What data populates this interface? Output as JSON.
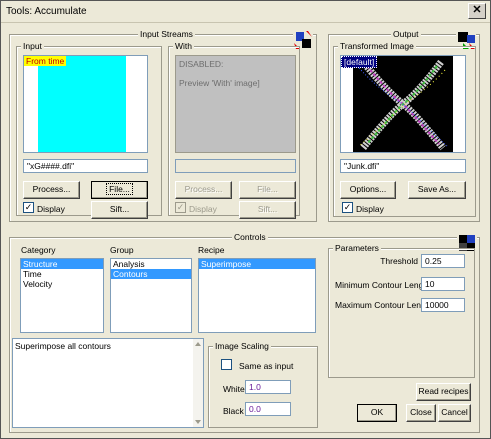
{
  "window": {
    "title": "Tools: Accumulate",
    "close_glyph": "✕"
  },
  "input_streams": {
    "legend": "Input Streams",
    "input": {
      "label": "Input",
      "preview_tag": "From time",
      "filename": "\"xG####.dfi\"",
      "process_label": "Process...",
      "file_label": "File...",
      "display_label": "Display",
      "display_checked": true,
      "sift_label": "Sift..."
    },
    "with": {
      "label": "With",
      "preview_line1": "DISABLED:",
      "preview_line2": "Preview 'With' image]",
      "filename": "",
      "process_label": "Process...",
      "file_label": "File...",
      "display_label": "Display",
      "display_checked": true,
      "sift_label": "Sift..."
    }
  },
  "output": {
    "legend": "Output",
    "label": "Transformed Image",
    "preview_tag": "[default]",
    "filename": "\"Junk.dfi\"",
    "options_label": "Options...",
    "save_as_label": "Save As...",
    "display_label": "Display",
    "display_checked": true
  },
  "controls": {
    "legend": "Controls",
    "category": {
      "label": "Category",
      "items": [
        "Structure",
        "Time",
        "Velocity"
      ],
      "selected": 0
    },
    "group": {
      "label": "Group",
      "items": [
        "Analysis",
        "Contours"
      ],
      "selected": 1
    },
    "recipe": {
      "label": "Recipe",
      "items": [
        "Superimpose"
      ],
      "selected": 0
    },
    "description": "Superimpose all contours",
    "scaling": {
      "legend": "Image Scaling",
      "same_as_input_label": "Same as input",
      "same_as_input_checked": false,
      "white_label": "White",
      "white_value": "1.0",
      "black_label": "Black",
      "black_value": "0.0"
    }
  },
  "parameters": {
    "legend": "Parameters",
    "rows": [
      {
        "label": "Threshold",
        "value": "0.25"
      },
      {
        "label": "Minimum Contour Lengt",
        "value": "10"
      },
      {
        "label": "Maximum Contour Leng",
        "value": "10000"
      }
    ]
  },
  "footer": {
    "read_recipes_label": "Read recipes",
    "ok_label": "OK",
    "close_label": "Close",
    "cancel_label": "Cancel"
  },
  "colors": {
    "input_preview": "#00ffff",
    "with_preview": "#c0c0c0",
    "output_preview": "#000000",
    "selection": "#3399ff"
  }
}
